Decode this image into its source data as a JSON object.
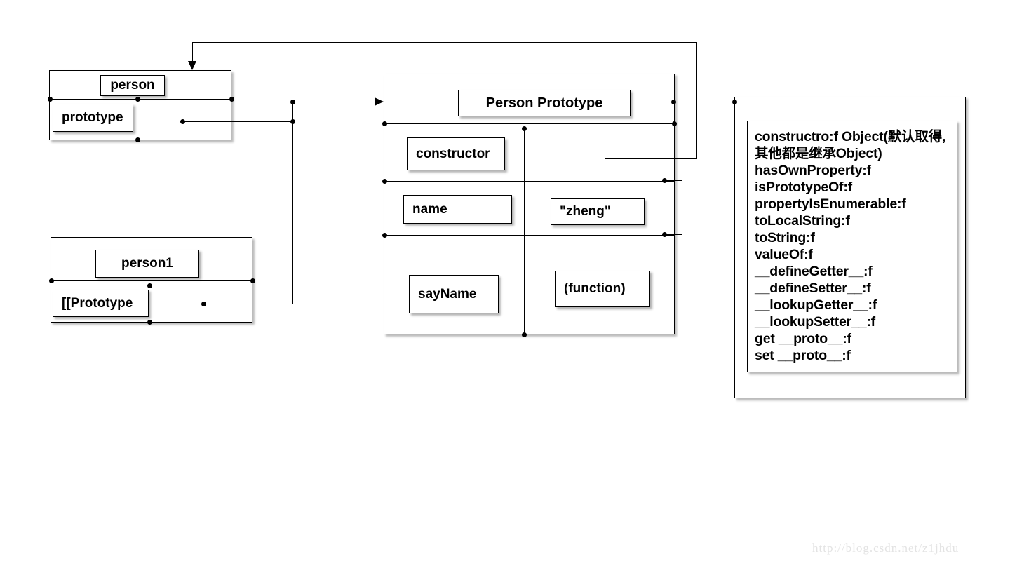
{
  "diagram": {
    "title": "JavaScript prototype chain diagram",
    "watermark": "http://blog.csdn.net/z1jhdu",
    "colors": {
      "line": "#000000",
      "background": "#ffffff",
      "watermark": "#e3e3e3"
    }
  },
  "person_object": {
    "title": "person",
    "rows": [
      {
        "key": "prototype",
        "value": ""
      }
    ]
  },
  "person1_object": {
    "title": "person1",
    "rows": [
      {
        "key": "[[Prototype",
        "value": ""
      }
    ]
  },
  "person_prototype": {
    "title": "Person Prototype",
    "rows": [
      {
        "key": "constructor",
        "value": ""
      },
      {
        "key": "name",
        "value": "\"zheng\""
      },
      {
        "key": "sayName",
        "value": "(function)"
      }
    ]
  },
  "object_prototype": {
    "properties": [
      "constructro:f Object(默认取得,其他都是继承Object)",
      "hasOwnProperty:f",
      "isPrototypeOf:f",
      "propertyIsEnumerable:f",
      "toLocalString:f",
      "toString:f",
      "valueOf:f",
      "__defineGetter__:f",
      "__defineSetter__:f",
      "__lookupGetter__:f",
      "__lookupSetter__:f",
      "get __proto__:f",
      "set __proto__:f"
    ]
  },
  "connectors": [
    {
      "name": "person-prototype-to-person-prototype-object",
      "from": "person.prototype",
      "to": "Person Prototype"
    },
    {
      "name": "person1-proto-to-person-prototype-object",
      "from": "person1.[[Prototype",
      "to": "Person Prototype"
    },
    {
      "name": "person-prototype-object-to-object-prototype",
      "from": "Person Prototype",
      "to": "Object prototype list"
    },
    {
      "name": "object-prototype-back-to-person",
      "from": "Object prototype list",
      "to": "person"
    }
  ]
}
